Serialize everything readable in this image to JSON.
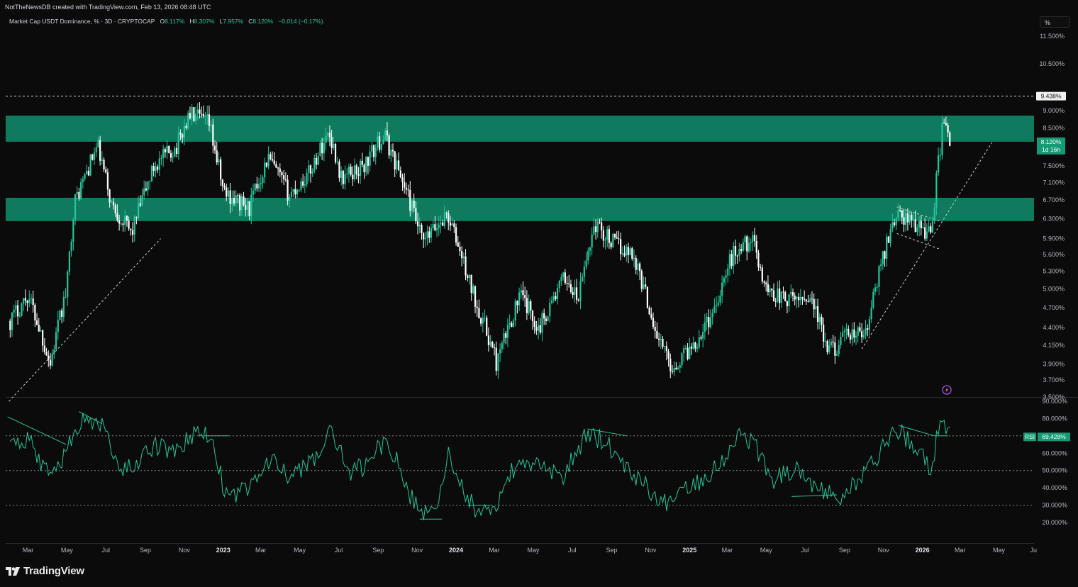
{
  "header": {
    "attribution": "NotTheNewsDB created with TradingView.com, Feb 13, 2026 08:48 UTC"
  },
  "legend": {
    "symbol": "Market Cap USDT Dominance, % · 3D · CRYPTOCAP",
    "o_label": "O",
    "o_value": "8.117%",
    "h_label": "H",
    "h_value": "8.307%",
    "l_label": "L",
    "l_value": "7.957%",
    "c_label": "C",
    "c_value": "8.120%",
    "change": "−0.014 (−0.17%)"
  },
  "scale_toggle": "%",
  "colors": {
    "background": "#0b0b0b",
    "zone": "#0f7a5e",
    "up": "#26c69a",
    "down": "#ffffff",
    "rsi": "#26c69a",
    "guide": "#cfcfcf"
  },
  "brand": {
    "name": "TradingView",
    "icon": "tradingview-logo-icon"
  },
  "chart_data": [
    {
      "type": "candlestick",
      "title": "Market Cap USDT Dominance, % · 3D · CRYPTOCAP",
      "x_ticks": [
        "Mar",
        "May",
        "Jul",
        "Sep",
        "Nov",
        "2023",
        "Mar",
        "May",
        "Jul",
        "Sep",
        "Nov",
        "2024",
        "Mar",
        "May",
        "Jul",
        "Sep",
        "Nov",
        "2025",
        "Mar",
        "May",
        "Jul",
        "Sep",
        "Nov",
        "2026",
        "Mar",
        "May",
        "Ju"
      ],
      "x_ticks_bold": [
        "2023",
        "2024",
        "2025",
        "2026"
      ],
      "y_ticks": [
        "11.500%",
        "10.500%",
        "9.000%",
        "8.500%",
        "7.500%",
        "7.100%",
        "6.700%",
        "6.300%",
        "5.900%",
        "5.600%",
        "5.300%",
        "5.000%",
        "4.700%",
        "4.400%",
        "4.150%",
        "3.900%",
        "3.700%",
        "3.500%"
      ],
      "y_scale": "log",
      "ylim": [
        3.5,
        11.8
      ],
      "markers": [
        {
          "label": "9.438%",
          "value": 9.438,
          "style": "dashed"
        },
        {
          "label": "8.120%",
          "sublabel": "1d 16h",
          "value": 8.12,
          "style": "last-price"
        }
      ],
      "zones": [
        {
          "from": 8.12,
          "to": 8.85
        },
        {
          "from": 6.25,
          "to": 6.75
        }
      ],
      "anchor_points": [
        {
          "t": "2022-02-01",
          "v": 4.5
        },
        {
          "t": "2022-03-01",
          "v": 4.9
        },
        {
          "t": "2022-04-05",
          "v": 3.9
        },
        {
          "t": "2022-05-01",
          "v": 5.0
        },
        {
          "t": "2022-05-12",
          "v": 6.6
        },
        {
          "t": "2022-06-18",
          "v": 8.0
        },
        {
          "t": "2022-07-10",
          "v": 6.6
        },
        {
          "t": "2022-08-10",
          "v": 6.0
        },
        {
          "t": "2022-09-15",
          "v": 7.5
        },
        {
          "t": "2022-10-20",
          "v": 8.0
        },
        {
          "t": "2022-11-10",
          "v": 8.9
        },
        {
          "t": "2022-12-10",
          "v": 8.6
        },
        {
          "t": "2023-01-01",
          "v": 6.9
        },
        {
          "t": "2023-02-10",
          "v": 6.5
        },
        {
          "t": "2023-03-12",
          "v": 7.7
        },
        {
          "t": "2023-04-15",
          "v": 6.8
        },
        {
          "t": "2023-05-15",
          "v": 7.3
        },
        {
          "t": "2023-06-16",
          "v": 8.4
        },
        {
          "t": "2023-07-05",
          "v": 7.2
        },
        {
          "t": "2023-08-10",
          "v": 7.5
        },
        {
          "t": "2023-09-10",
          "v": 8.3
        },
        {
          "t": "2023-10-10",
          "v": 7.1
        },
        {
          "t": "2023-11-10",
          "v": 5.8
        },
        {
          "t": "2023-12-18",
          "v": 6.4
        },
        {
          "t": "2024-01-25",
          "v": 5.0
        },
        {
          "t": "2024-03-05",
          "v": 3.9
        },
        {
          "t": "2024-04-10",
          "v": 4.9
        },
        {
          "t": "2024-05-10",
          "v": 4.4
        },
        {
          "t": "2024-06-20",
          "v": 5.2
        },
        {
          "t": "2024-07-10",
          "v": 4.8
        },
        {
          "t": "2024-08-05",
          "v": 6.2
        },
        {
          "t": "2024-09-05",
          "v": 5.8
        },
        {
          "t": "2024-10-05",
          "v": 5.6
        },
        {
          "t": "2024-11-10",
          "v": 4.3
        },
        {
          "t": "2024-12-05",
          "v": 3.85
        },
        {
          "t": "2025-01-10",
          "v": 4.2
        },
        {
          "t": "2025-02-05",
          "v": 4.6
        },
        {
          "t": "2025-03-10",
          "v": 5.6
        },
        {
          "t": "2025-04-08",
          "v": 5.9
        },
        {
          "t": "2025-05-01",
          "v": 5.0
        },
        {
          "t": "2025-06-05",
          "v": 4.8
        },
        {
          "t": "2025-07-10",
          "v": 4.9
        },
        {
          "t": "2025-08-05",
          "v": 4.05
        },
        {
          "t": "2025-09-10",
          "v": 4.3
        },
        {
          "t": "2025-10-05",
          "v": 4.3
        },
        {
          "t": "2025-11-01",
          "v": 5.6
        },
        {
          "t": "2025-11-20",
          "v": 6.4
        },
        {
          "t": "2025-12-20",
          "v": 6.2
        },
        {
          "t": "2026-01-15",
          "v": 6.0
        },
        {
          "t": "2026-02-05",
          "v": 9.0
        },
        {
          "t": "2026-02-13",
          "v": 8.12
        }
      ]
    },
    {
      "type": "line",
      "title": "RSI",
      "current_label": "RSI",
      "current_value_label": "69.428%",
      "current_value": 69.428,
      "y_ticks": [
        "90.000%",
        "80.000%",
        "70.000%",
        "60.000%",
        "50.000%",
        "40.000%",
        "30.000%",
        "20.000%"
      ],
      "ylim": [
        18,
        92
      ],
      "levels": [
        70,
        50,
        30
      ],
      "anchor_points": [
        {
          "t": "2022-02-01",
          "v": 62
        },
        {
          "t": "2022-03-01",
          "v": 68
        },
        {
          "t": "2022-04-05",
          "v": 45
        },
        {
          "t": "2022-05-12",
          "v": 70
        },
        {
          "t": "2022-06-01",
          "v": 82
        },
        {
          "t": "2022-06-25",
          "v": 75
        },
        {
          "t": "2022-07-20",
          "v": 52
        },
        {
          "t": "2022-08-15",
          "v": 50
        },
        {
          "t": "2022-09-15",
          "v": 65
        },
        {
          "t": "2022-10-20",
          "v": 60
        },
        {
          "t": "2022-11-15",
          "v": 72
        },
        {
          "t": "2022-12-15",
          "v": 70
        },
        {
          "t": "2023-01-05",
          "v": 35
        },
        {
          "t": "2023-02-15",
          "v": 40
        },
        {
          "t": "2023-03-15",
          "v": 58
        },
        {
          "t": "2023-04-15",
          "v": 45
        },
        {
          "t": "2023-05-20",
          "v": 55
        },
        {
          "t": "2023-06-20",
          "v": 72
        },
        {
          "t": "2023-07-20",
          "v": 48
        },
        {
          "t": "2023-08-20",
          "v": 55
        },
        {
          "t": "2023-09-15",
          "v": 70
        },
        {
          "t": "2023-10-10",
          "v": 45
        },
        {
          "t": "2023-11-05",
          "v": 25
        },
        {
          "t": "2023-12-05",
          "v": 30
        },
        {
          "t": "2023-12-20",
          "v": 60
        },
        {
          "t": "2024-01-20",
          "v": 32
        },
        {
          "t": "2024-02-25",
          "v": 22
        },
        {
          "t": "2024-03-25",
          "v": 48
        },
        {
          "t": "2024-05-01",
          "v": 55
        },
        {
          "t": "2024-06-15",
          "v": 45
        },
        {
          "t": "2024-07-25",
          "v": 72
        },
        {
          "t": "2024-08-25",
          "v": 66
        },
        {
          "t": "2024-09-25",
          "v": 52
        },
        {
          "t": "2024-10-25",
          "v": 42
        },
        {
          "t": "2024-11-20",
          "v": 30
        },
        {
          "t": "2024-12-20",
          "v": 40
        },
        {
          "t": "2025-01-20",
          "v": 45
        },
        {
          "t": "2025-02-20",
          "v": 55
        },
        {
          "t": "2025-03-15",
          "v": 70
        },
        {
          "t": "2025-04-08",
          "v": 68
        },
        {
          "t": "2025-05-10",
          "v": 45
        },
        {
          "t": "2025-06-20",
          "v": 52
        },
        {
          "t": "2025-07-25",
          "v": 38
        },
        {
          "t": "2025-08-25",
          "v": 34
        },
        {
          "t": "2025-09-25",
          "v": 45
        },
        {
          "t": "2025-10-25",
          "v": 60
        },
        {
          "t": "2025-11-20",
          "v": 75
        },
        {
          "t": "2025-12-20",
          "v": 62
        },
        {
          "t": "2026-01-15",
          "v": 52
        },
        {
          "t": "2026-02-01",
          "v": 84
        },
        {
          "t": "2026-02-13",
          "v": 69.428
        }
      ]
    }
  ]
}
